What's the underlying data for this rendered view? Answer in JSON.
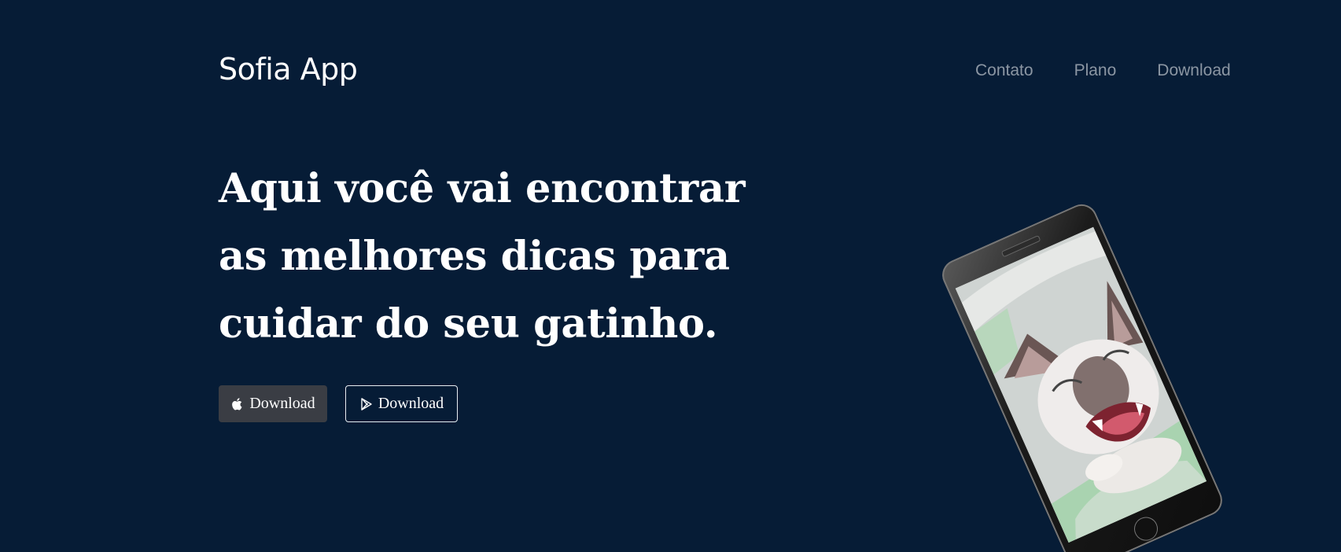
{
  "brand": {
    "name": "Sofia App"
  },
  "nav": {
    "items": [
      {
        "label": "Contato"
      },
      {
        "label": "Plano"
      },
      {
        "label": "Download"
      }
    ]
  },
  "hero": {
    "headline": "Aqui você vai encontrar as melhores dicas para cuidar do seu gatinho.",
    "buttons": [
      {
        "label": "Download",
        "icon": "apple-icon"
      },
      {
        "label": "Download",
        "icon": "google-play-icon"
      }
    ]
  },
  "phone_image": {
    "subject": "cat-photo"
  },
  "colors": {
    "background": "#061c36",
    "nav_text": "#8b96a3",
    "apple_button_bg": "#3a3d44",
    "play_button_border": "#e9edf2"
  }
}
